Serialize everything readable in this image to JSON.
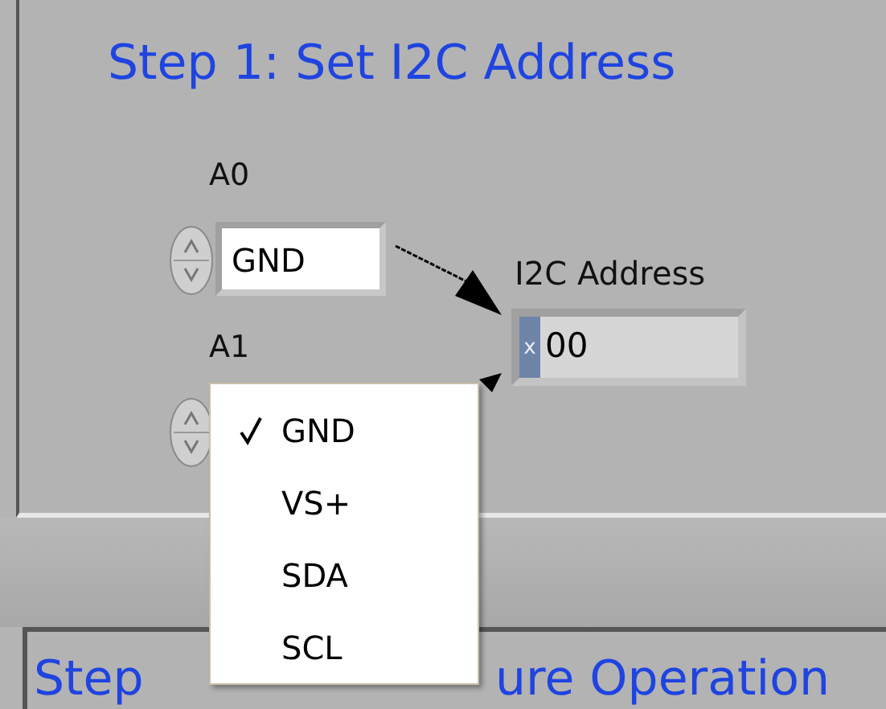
{
  "step1": {
    "title": "Step 1: Set I2C Address",
    "controls": [
      {
        "label": "A0",
        "value": "GND"
      },
      {
        "label": "A1"
      }
    ],
    "indicator": {
      "label": "I2C Address",
      "radix": "x",
      "value": "00"
    }
  },
  "menu": {
    "items": [
      {
        "label": "GND",
        "selected": true
      },
      {
        "label": "VS+",
        "selected": false
      },
      {
        "label": "SDA",
        "selected": false
      },
      {
        "label": "SCL",
        "selected": false
      }
    ]
  },
  "step2": {
    "title_parts": [
      "Step",
      "ure Operation"
    ]
  }
}
